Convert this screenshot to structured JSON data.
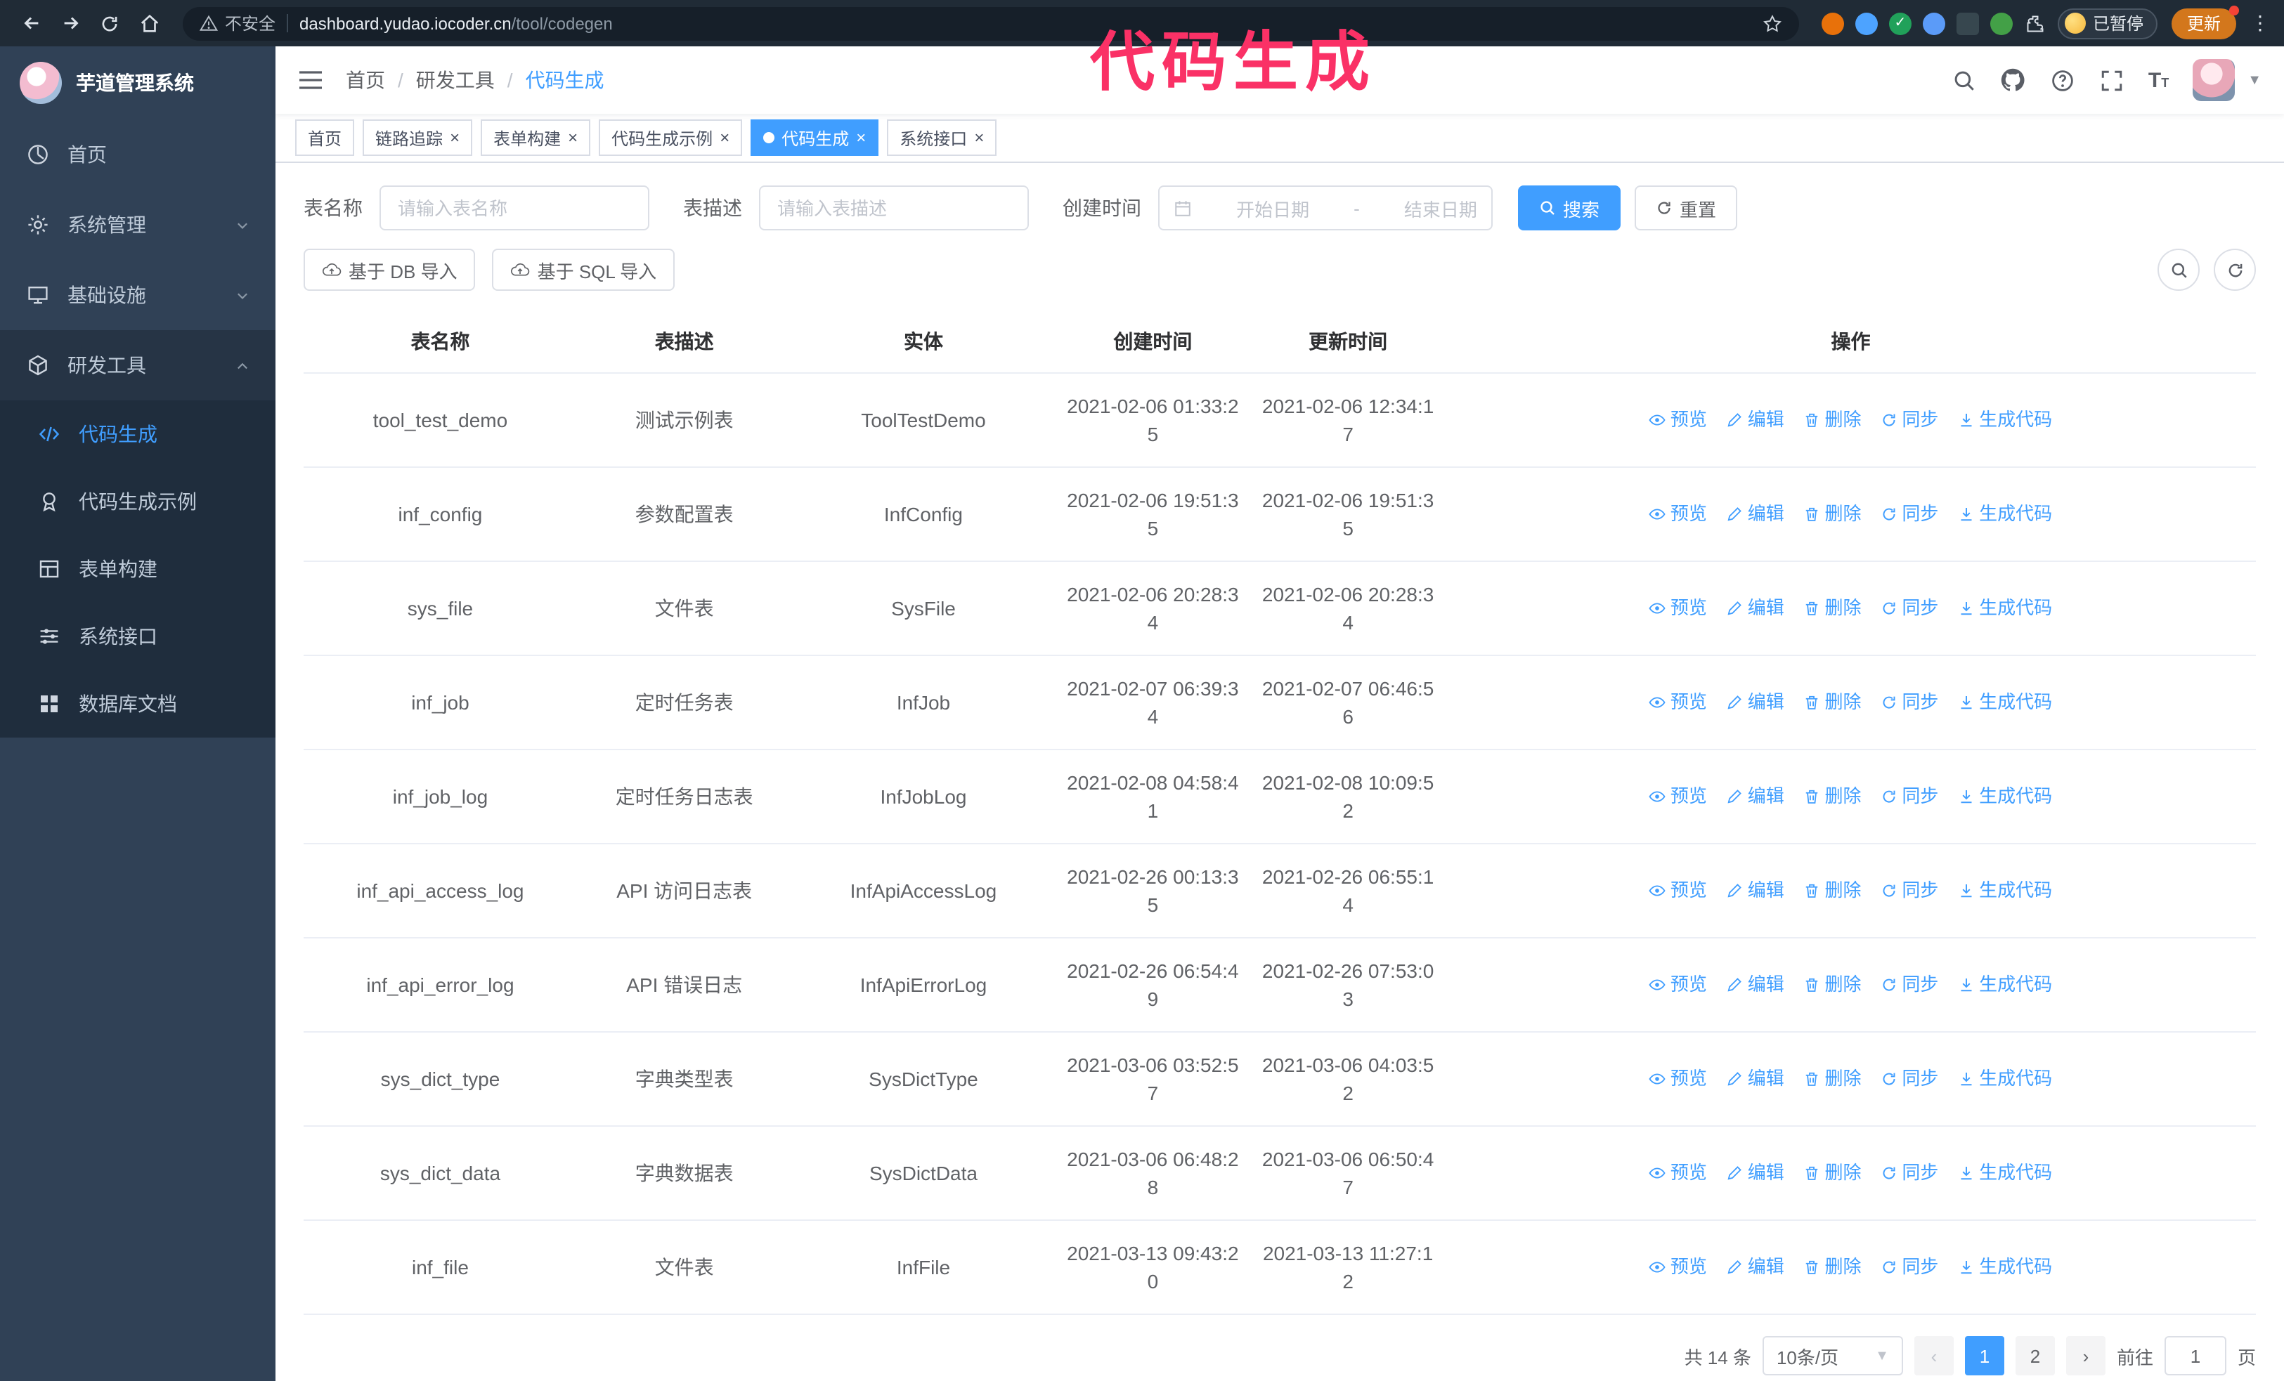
{
  "colors": {
    "accent": "#409eff",
    "sidebar_bg": "#304156",
    "submenu_bg": "#1f2d3d",
    "annotation": "#fa3166",
    "chrome_bg": "#202b36",
    "update_button_bg": "#d3771c"
  },
  "annotation": {
    "text": "代码生成"
  },
  "browser": {
    "security_label": "不安全",
    "url_host": "dashboard.yudao.iocoder.cn",
    "url_path": "/tool/codegen",
    "paused_badge": "已暂停",
    "update_button": "更新"
  },
  "sidebar": {
    "app_title": "芋道管理系统",
    "items": [
      {
        "label": "首页"
      },
      {
        "label": "系统管理"
      },
      {
        "label": "基础设施"
      },
      {
        "label": "研发工具"
      }
    ],
    "subitems": [
      {
        "label": "代码生成"
      },
      {
        "label": "代码生成示例"
      },
      {
        "label": "表单构建"
      },
      {
        "label": "系统接口"
      },
      {
        "label": "数据库文档"
      }
    ]
  },
  "breadcrumb": {
    "separator": "/",
    "items": [
      "首页",
      "研发工具",
      "代码生成"
    ]
  },
  "tabs": [
    {
      "label": "首页"
    },
    {
      "label": "链路追踪"
    },
    {
      "label": "表单构建"
    },
    {
      "label": "代码生成示例"
    },
    {
      "label": "代码生成"
    },
    {
      "label": "系统接口"
    }
  ],
  "filters": {
    "table_name_label": "表名称",
    "table_name_placeholder": "请输入表名称",
    "table_desc_label": "表描述",
    "table_desc_placeholder": "请输入表描述",
    "create_time_label": "创建时间",
    "date_start_placeholder": "开始日期",
    "date_separator": "-",
    "date_end_placeholder": "结束日期",
    "search_button": "搜索",
    "reset_button": "重置"
  },
  "toolbar": {
    "import_db_label": "基于 DB 导入",
    "import_sql_label": "基于 SQL 导入"
  },
  "table": {
    "columns": [
      "表名称",
      "表描述",
      "实体",
      "创建时间",
      "更新时间",
      "操作"
    ],
    "action_labels": [
      "预览",
      "编辑",
      "删除",
      "同步",
      "生成代码"
    ],
    "rows": [
      {
        "name": "tool_test_demo",
        "desc": "测试示例表",
        "entity": "ToolTestDemo",
        "created": "2021-02-06 01:33:25",
        "updated": "2021-02-06 12:34:17"
      },
      {
        "name": "inf_config",
        "desc": "参数配置表",
        "entity": "InfConfig",
        "created": "2021-02-06 19:51:35",
        "updated": "2021-02-06 19:51:35"
      },
      {
        "name": "sys_file",
        "desc": "文件表",
        "entity": "SysFile",
        "created": "2021-02-06 20:28:34",
        "updated": "2021-02-06 20:28:34"
      },
      {
        "name": "inf_job",
        "desc": "定时任务表",
        "entity": "InfJob",
        "created": "2021-02-07 06:39:34",
        "updated": "2021-02-07 06:46:56"
      },
      {
        "name": "inf_job_log",
        "desc": "定时任务日志表",
        "entity": "InfJobLog",
        "created": "2021-02-08 04:58:41",
        "updated": "2021-02-08 10:09:52"
      },
      {
        "name": "inf_api_access_log",
        "desc": "API 访问日志表",
        "entity": "InfApiAccessLog",
        "created": "2021-02-26 00:13:35",
        "updated": "2021-02-26 06:55:14"
      },
      {
        "name": "inf_api_error_log",
        "desc": "API 错误日志",
        "entity": "InfApiErrorLog",
        "created": "2021-02-26 06:54:49",
        "updated": "2021-02-26 07:53:03"
      },
      {
        "name": "sys_dict_type",
        "desc": "字典类型表",
        "entity": "SysDictType",
        "created": "2021-03-06 03:52:57",
        "updated": "2021-03-06 04:03:52"
      },
      {
        "name": "sys_dict_data",
        "desc": "字典数据表",
        "entity": "SysDictData",
        "created": "2021-03-06 06:48:28",
        "updated": "2021-03-06 06:50:47"
      },
      {
        "name": "inf_file",
        "desc": "文件表",
        "entity": "InfFile",
        "created": "2021-03-13 09:43:20",
        "updated": "2021-03-13 11:27:12"
      }
    ]
  },
  "pagination": {
    "total": "共 14 条",
    "page_size": "10条/页",
    "pages": [
      "1",
      "2"
    ],
    "goto_label": "前往",
    "goto_value": "1",
    "goto_suffix": "页"
  }
}
